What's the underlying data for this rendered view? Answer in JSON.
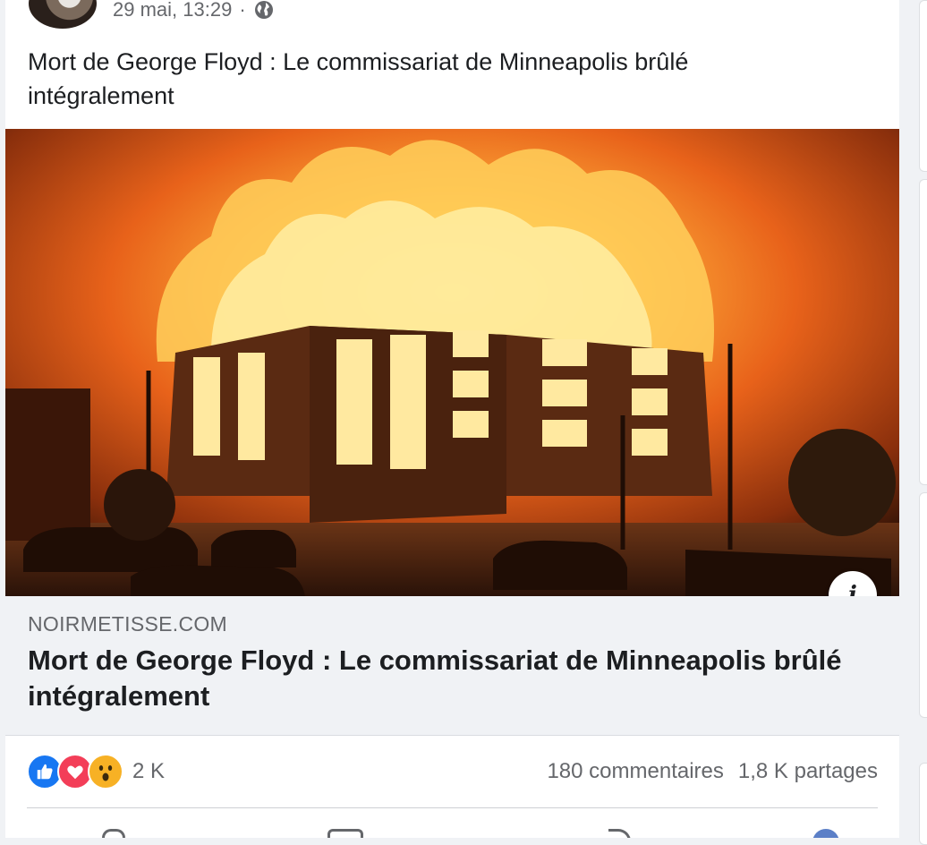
{
  "post": {
    "timestamp": "29 mai, 13:29",
    "separator": "·",
    "audience_icon": "globe-icon",
    "text": "Mort de George Floyd : Le commissariat de Minneapolis brûlé intégralement",
    "photo_icon": "info-icon",
    "info_label": "i"
  },
  "link_preview": {
    "domain": "NOIRMETISSE.COM",
    "title": "Mort de George Floyd : Le commissariat de Minneapolis brûlé intégralement"
  },
  "engagement": {
    "reaction_icons": [
      "like-icon",
      "love-icon",
      "wow-icon"
    ],
    "reaction_count": "2 K",
    "comments": "180 commentaires",
    "shares": "1,8 K partages"
  },
  "colors": {
    "like": "#1877f2",
    "love": "#f33e58",
    "wow": "#f7b125",
    "secondary_text": "#65676b",
    "card_bg": "#f0f2f5"
  }
}
